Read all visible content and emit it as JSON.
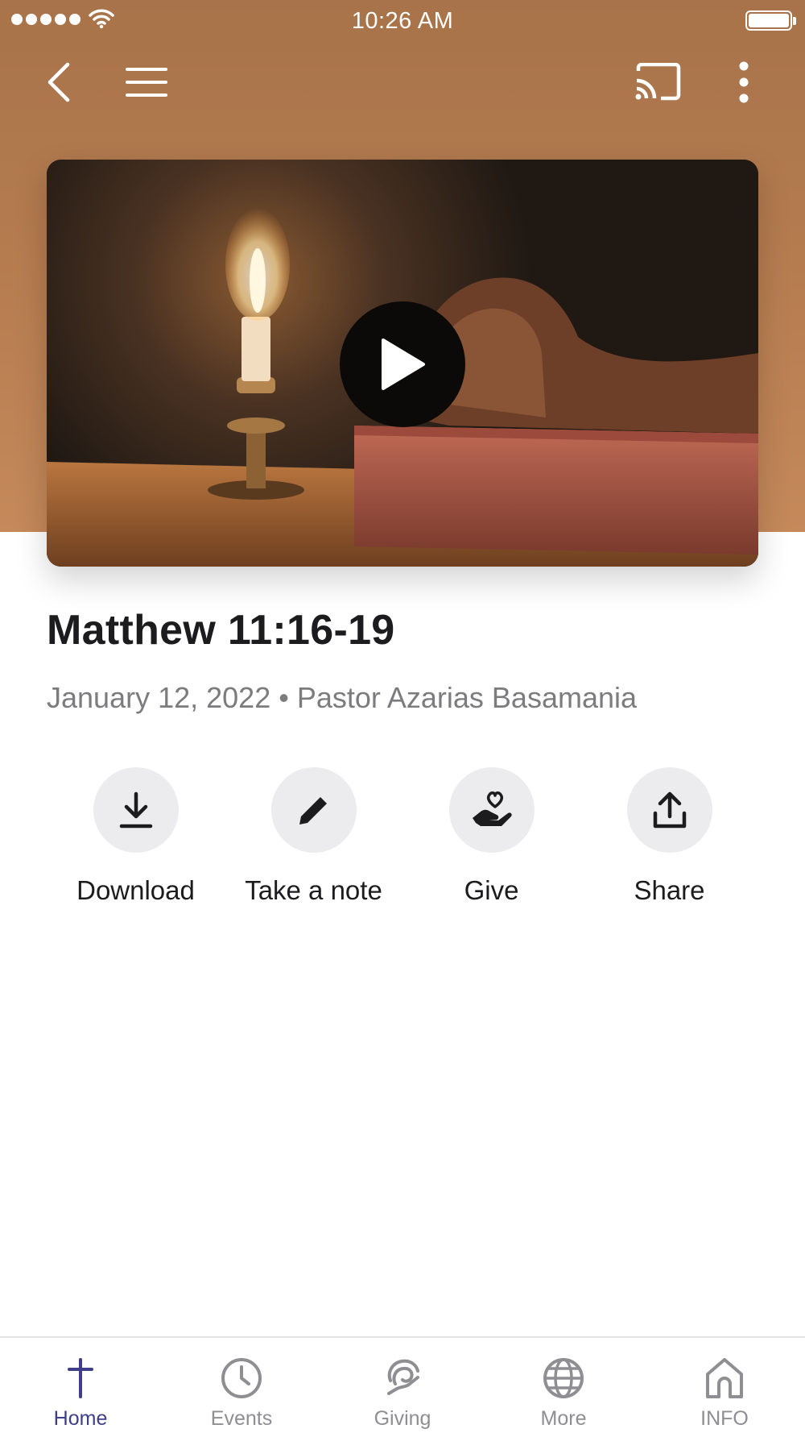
{
  "status_bar": {
    "time": "10:26 AM"
  },
  "toolbar": {
    "back_icon": "chevron-left-icon",
    "menu_icon": "hamburger-menu-icon",
    "cast_icon": "cast-icon",
    "more_icon": "more-vertical-icon"
  },
  "colors": {
    "hero_background": "#b47b4f",
    "accent": "#3e3e8a",
    "inactive_tab": "#8e8e93",
    "action_circle": "#ececee"
  },
  "video": {
    "thumbnail": "candle and praying hands on bible",
    "play_icon": "play-icon"
  },
  "sermon": {
    "title": "Matthew 11:16-19",
    "meta": "January 12, 2022 • Pastor Azarias Basamania"
  },
  "actions": [
    {
      "label": "Download",
      "icon": "download-icon"
    },
    {
      "label": "Take a note",
      "icon": "pencil-icon"
    },
    {
      "label": "Give",
      "icon": "heart-hand-icon"
    },
    {
      "label": "Share",
      "icon": "share-icon"
    }
  ],
  "tabs": [
    {
      "label": "Home",
      "icon": "cross-icon",
      "active": true
    },
    {
      "label": "Events",
      "icon": "clock-icon",
      "active": false
    },
    {
      "label": "Giving",
      "icon": "giving-icon",
      "active": false
    },
    {
      "label": "More",
      "icon": "globe-icon",
      "active": false
    },
    {
      "label": "INFO",
      "icon": "house-icon",
      "active": false
    }
  ]
}
